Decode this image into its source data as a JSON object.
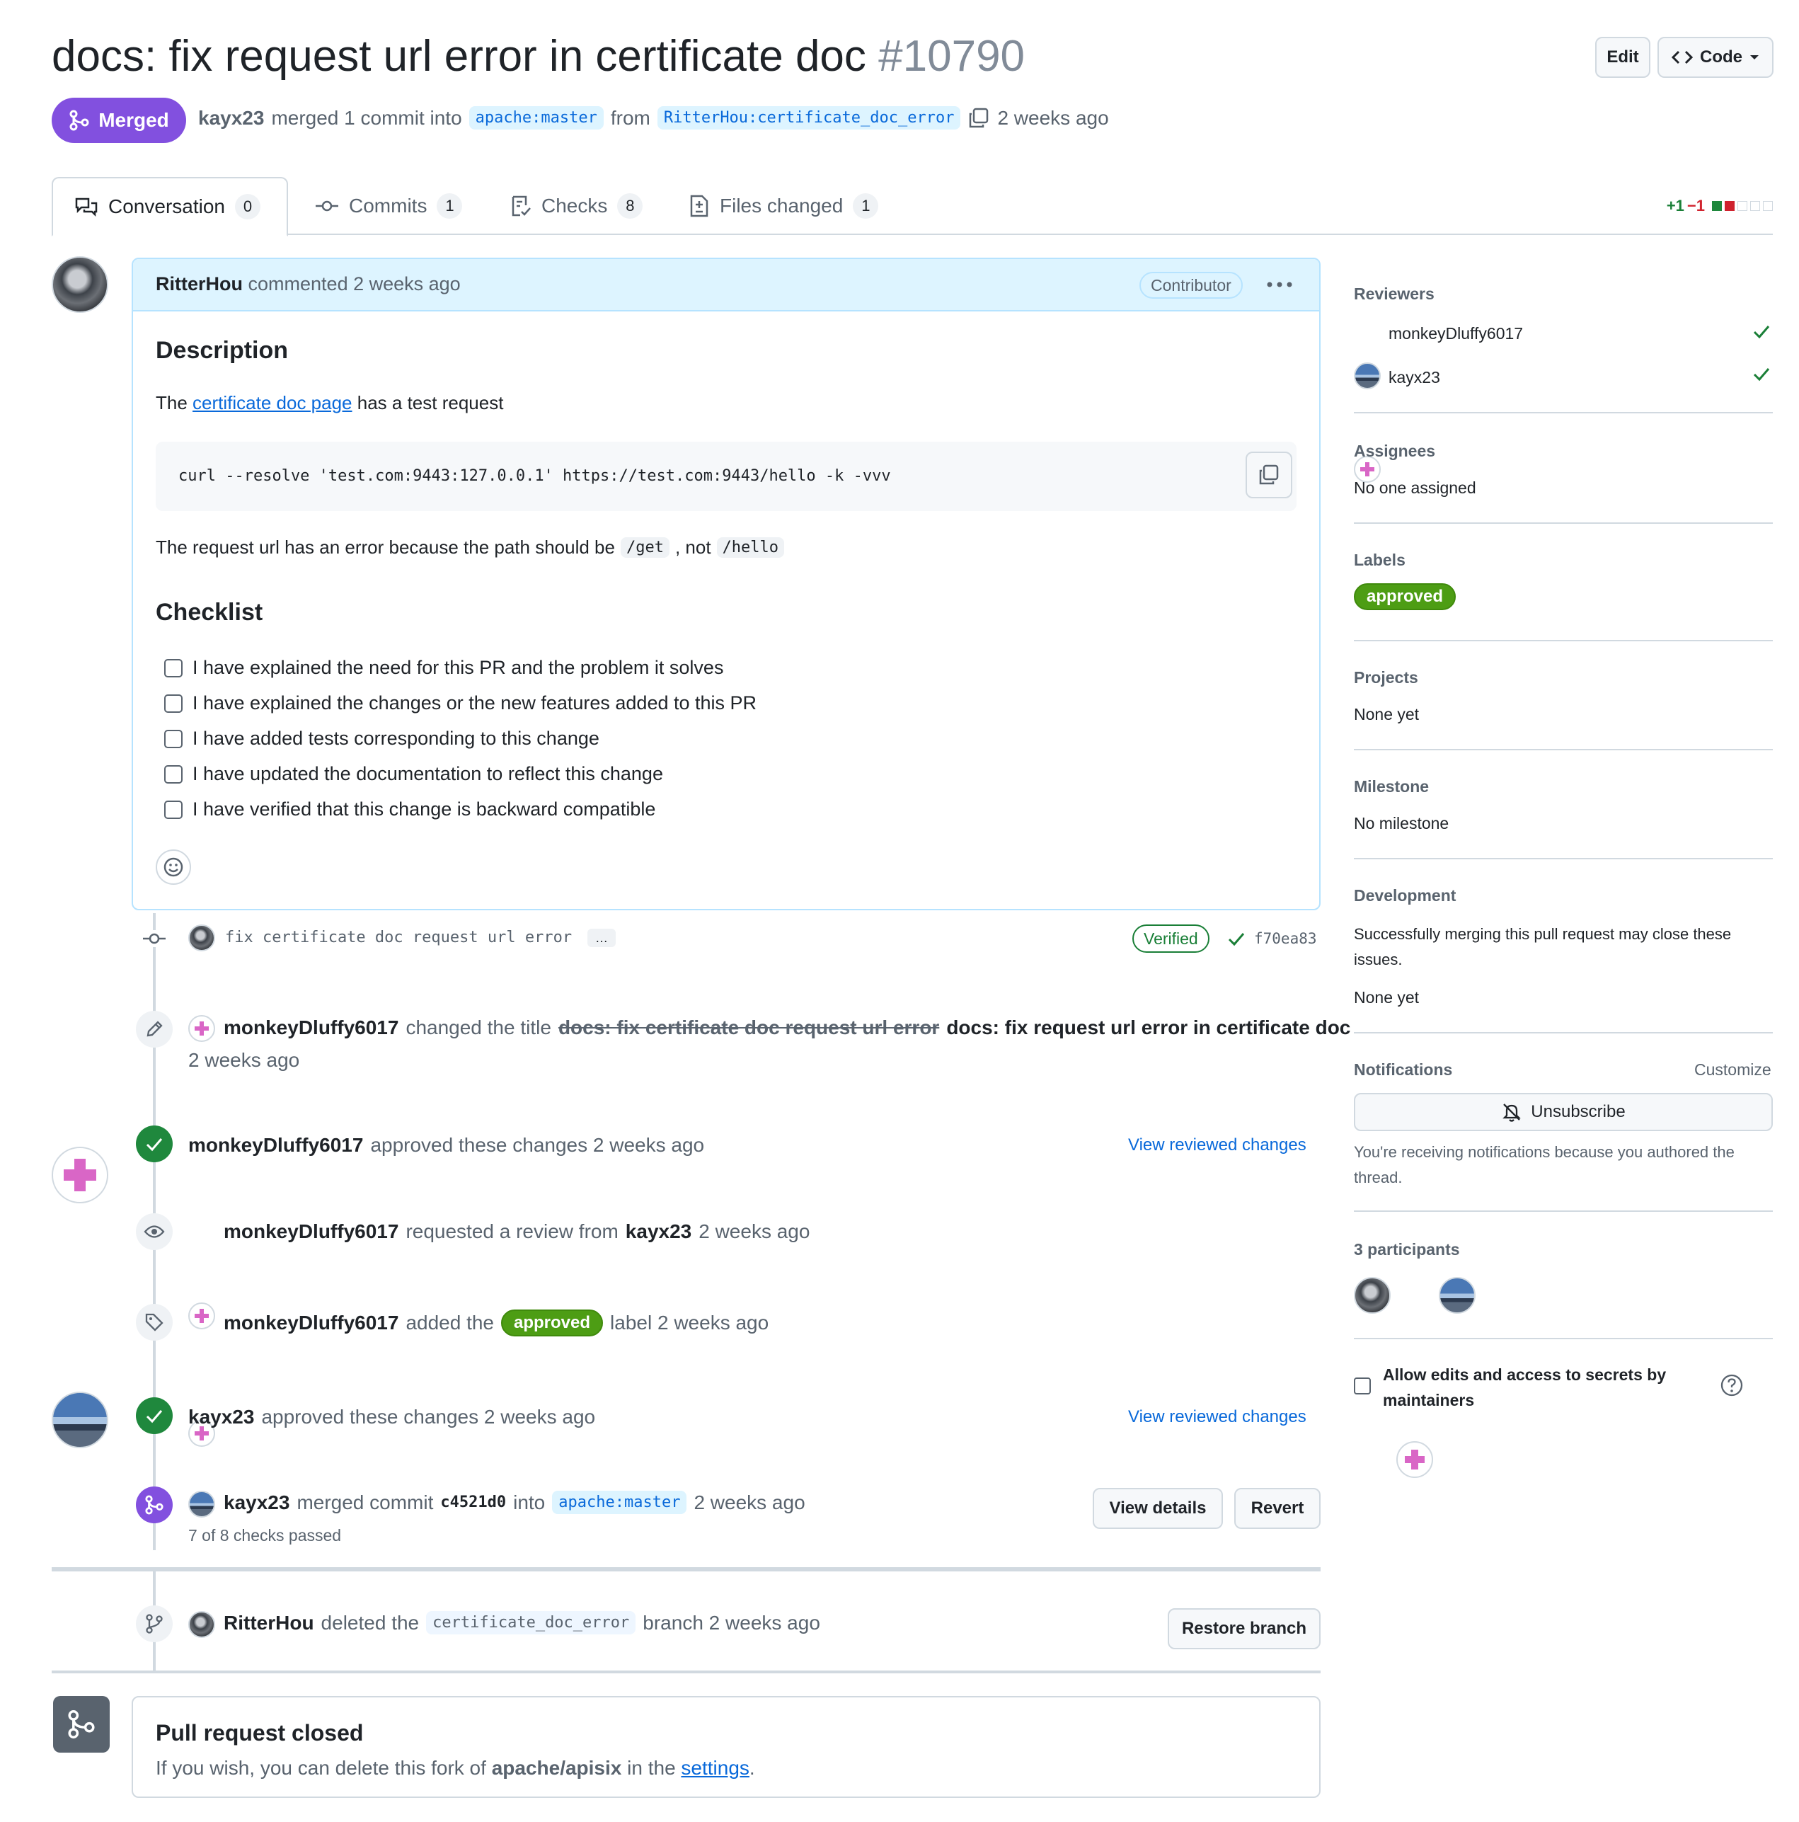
{
  "pr": {
    "title": "docs: fix request url error in certificate doc",
    "number": "#10790",
    "state": "Merged",
    "author": "kayx23",
    "merged_text": "merged 1 commit into",
    "base_branch": "apache:master",
    "from_text": "from",
    "head_branch": "RitterHou:certificate_doc_error",
    "time": "2 weeks ago"
  },
  "header_buttons": {
    "edit": "Edit",
    "code": "Code"
  },
  "tabs": [
    {
      "label": "Conversation",
      "count": "0"
    },
    {
      "label": "Commits",
      "count": "1"
    },
    {
      "label": "Checks",
      "count": "8"
    },
    {
      "label": "Files changed",
      "count": "1"
    }
  ],
  "diffstat": {
    "additions": "+1",
    "deletions": "−1"
  },
  "comment": {
    "author": "RitterHou",
    "action": "commented 2 weeks ago",
    "badge": "Contributor",
    "description_heading": "Description",
    "para1_pre": "The",
    "para1_link": "certificate doc page",
    "para1_post": "has a test request",
    "code": "curl --resolve 'test.com:9443:127.0.0.1' https://test.com:9443/hello -k -vvv",
    "para2_pre": "The request url has an error because the path should be",
    "para2_code1": "/get",
    "para2_mid": ", not",
    "para2_code2": "/hello",
    "checklist_heading": "Checklist",
    "checklist": [
      "I have explained the need for this PR and the problem it solves",
      "I have explained the changes or the new features added to this PR",
      "I have added tests corresponding to this change",
      "I have updated the documentation to reflect this change",
      "I have verified that this change is backward compatible"
    ]
  },
  "timeline": {
    "commit": {
      "message": "fix certificate doc request url error",
      "ellipsis": "…",
      "verified": "Verified",
      "sha": "f70ea83"
    },
    "title_change": {
      "user": "monkeyDluffy6017",
      "action": "changed the title",
      "old": "docs: fix certificate doc request url error",
      "new": "docs: fix request url error in certificate doc",
      "time": "2 weeks ago"
    },
    "approval1": {
      "user": "monkeyDluffy6017",
      "action": "approved these changes 2 weeks ago",
      "link": "View reviewed changes"
    },
    "review_request": {
      "user": "monkeyDluffy6017",
      "action": "requested a review from",
      "target": "kayx23",
      "time": "2 weeks ago"
    },
    "label_added": {
      "user": "monkeyDluffy6017",
      "action": "added the",
      "label": "approved",
      "post": "label 2 weeks ago"
    },
    "approval2": {
      "user": "kayx23",
      "action": "approved these changes 2 weeks ago",
      "link": "View reviewed changes"
    },
    "merge": {
      "user": "kayx23",
      "action": "merged commit",
      "sha": "c4521d0",
      "into": "into",
      "branch": "apache:master",
      "time": "2 weeks ago",
      "checks": "7 of 8 checks passed",
      "details_btn": "View details",
      "revert_btn": "Revert"
    },
    "branch_deleted": {
      "user": "RitterHou",
      "action": "deleted the",
      "branch": "certificate_doc_error",
      "post": "branch 2 weeks ago",
      "restore_btn": "Restore branch"
    },
    "closed": {
      "heading": "Pull request closed",
      "text_pre": "If you wish, you can delete this fork of",
      "repo": "apache/apisix",
      "text_mid": "in the",
      "link": "settings",
      "text_post": "."
    }
  },
  "sidebar": {
    "reviewers_heading": "Reviewers",
    "reviewers": [
      "monkeyDluffy6017",
      "kayx23"
    ],
    "assignees_heading": "Assignees",
    "assignees_value": "No one assigned",
    "labels_heading": "Labels",
    "label": "approved",
    "projects_heading": "Projects",
    "projects_value": "None yet",
    "milestone_heading": "Milestone",
    "milestone_value": "No milestone",
    "development_heading": "Development",
    "development_text": "Successfully merging this pull request may close these issues.",
    "development_value": "None yet",
    "notifications_heading": "Notifications",
    "customize": "Customize",
    "unsubscribe": "Unsubscribe",
    "notif_reason": "You're receiving notifications because you authored the thread.",
    "participants_heading": "3 participants",
    "allow_edits": "Allow edits and access to secrets by maintainers"
  },
  "colors": {
    "merged": "#8250df",
    "approved_label": "#4d9d14",
    "link": "#0969da",
    "success": "#1f883d"
  }
}
